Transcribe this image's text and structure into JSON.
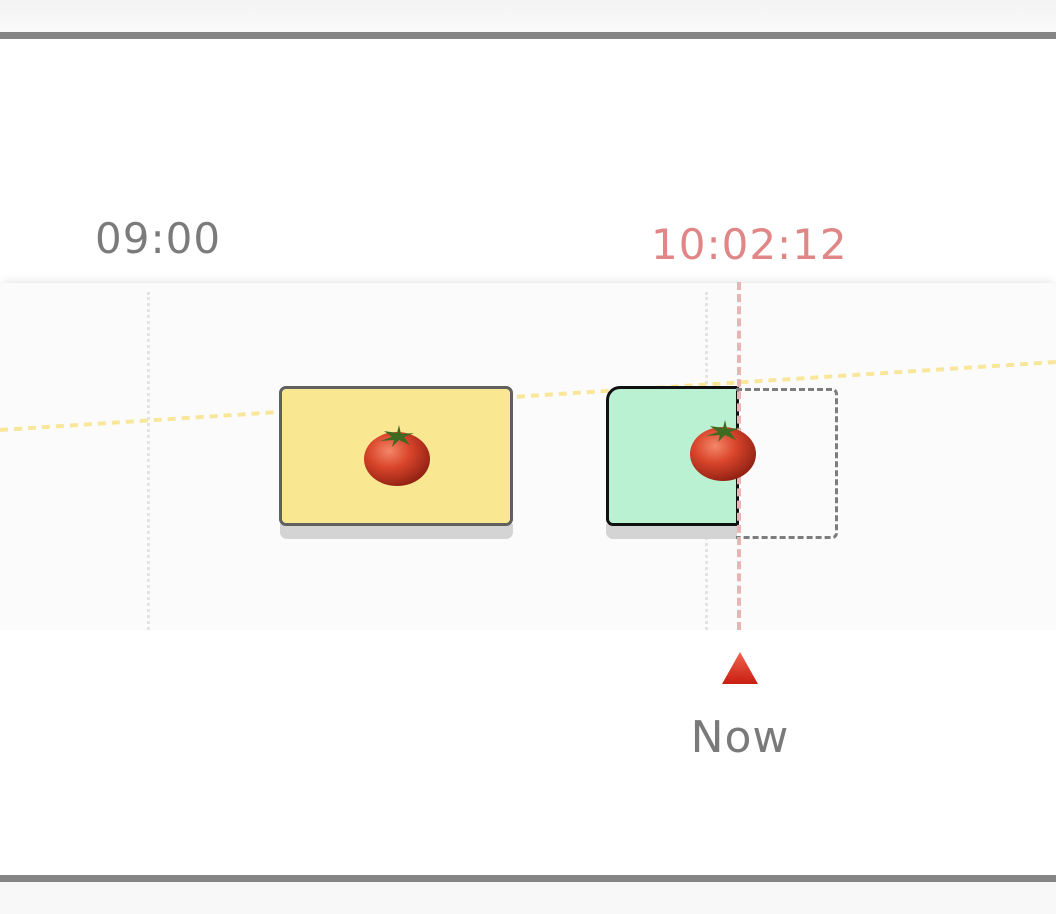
{
  "timeline": {
    "hour_label": "09:00",
    "current_time": "10:02:12",
    "now_label": "Now"
  },
  "sessions": [
    {
      "status": "completed",
      "icon": "tomato-icon"
    },
    {
      "status": "in-progress",
      "icon": "tomato-icon"
    },
    {
      "status": "planned"
    }
  ],
  "colors": {
    "completed_fill": "#fae792",
    "active_fill": "#baf1d2",
    "now_time": "#e08686",
    "now_line": "#e8b4b4",
    "trend_line": "#f8e79a",
    "frame_border": "#858585",
    "now_marker": "#e0301e"
  }
}
